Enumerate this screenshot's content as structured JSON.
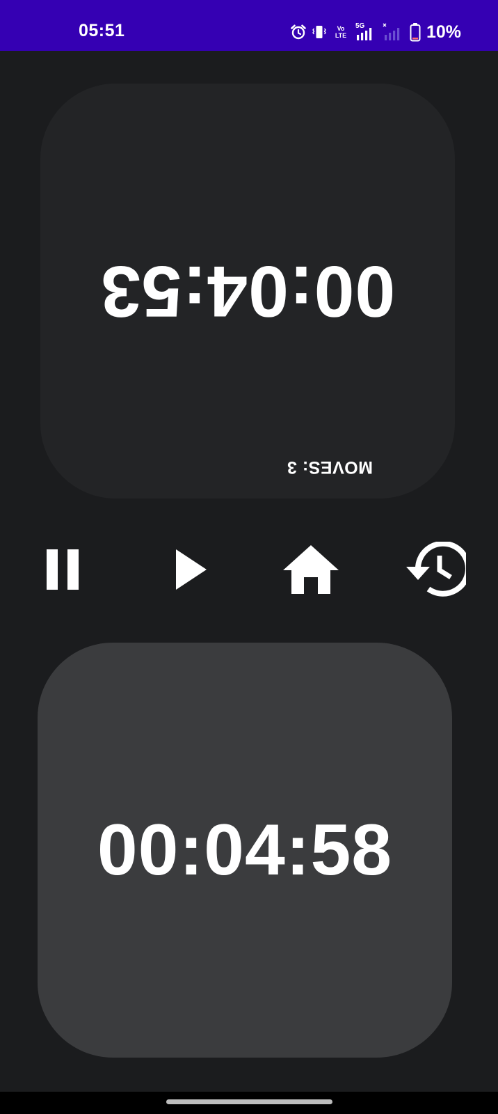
{
  "status_bar": {
    "time": "05:51",
    "battery_percent": "10%",
    "network_label": "5G",
    "volte_label_top": "Vo",
    "volte_label_bottom": "LTE",
    "background_color": "#3500b3",
    "icons": [
      "alarm-icon",
      "vibrate-icon",
      "volte-icon",
      "signal-5g-icon",
      "signal-no-service-icon",
      "battery-icon"
    ]
  },
  "opponent_panel": {
    "clock": "00:04:53",
    "moves_text": "MOVES: 3",
    "background_color": "#232426",
    "orientation": "rotated-180"
  },
  "player_panel": {
    "clock": "00:04:58",
    "background_color": "#3b3c3e"
  },
  "controls": {
    "items": [
      "pause-icon",
      "play-icon",
      "home-icon",
      "history-icon"
    ]
  },
  "theme": {
    "background": "#1b1c1e",
    "text": "#ffffff"
  }
}
